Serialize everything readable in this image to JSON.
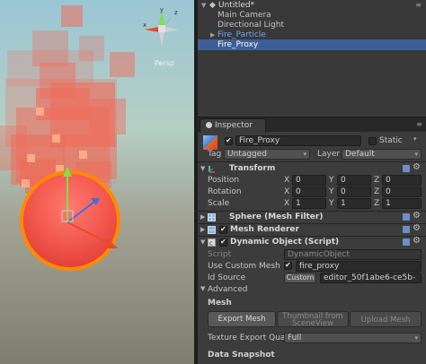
{
  "scene": {
    "view_label": "Persp",
    "gizmo_axes": [
      "y",
      "x",
      "z"
    ]
  },
  "hierarchy": {
    "scene_title": "Untitled*",
    "items": [
      {
        "label": "Main Camera"
      },
      {
        "label": "Directional Light"
      },
      {
        "label": "Fire_Particle"
      },
      {
        "label": "Fire_Proxy"
      }
    ],
    "selected": "Fire_Proxy"
  },
  "inspector": {
    "tab_label": "Inspector",
    "object": {
      "name": "Fire_Proxy",
      "active": true,
      "static_label": "Static",
      "tag_label": "Tag",
      "tag_value": "Untagged",
      "layer_label": "Layer",
      "layer_value": "Default"
    },
    "transform": {
      "title": "Transform",
      "rows": [
        {
          "label": "Position",
          "x": "0",
          "y": "0",
          "z": "0"
        },
        {
          "label": "Rotation",
          "x": "0",
          "y": "0",
          "z": "0"
        },
        {
          "label": "Scale",
          "x": "1",
          "y": "1",
          "z": "1"
        }
      ],
      "axis_x": "X",
      "axis_y": "Y",
      "axis_z": "Z"
    },
    "mesh_filter": {
      "title": "Sphere (Mesh Filter)"
    },
    "mesh_renderer": {
      "title": "Mesh Renderer",
      "enabled": true
    },
    "dynamic_object": {
      "title": "Dynamic Object (Script)",
      "enabled": true,
      "script_label": "Script",
      "script_value": "DynamicObject",
      "use_custom_mesh_label": "Use Custom Mesh",
      "use_custom_mesh_value": "fire_proxy",
      "id_source_label": "Id Source",
      "id_source_mode": "Custom",
      "id_source_value": "editor_50f1abe6-ce5b-",
      "advanced_label": "Advanced",
      "mesh_section": "Mesh",
      "export_mesh": "Export Mesh",
      "thumbnail_line1": "Thumbnail from",
      "thumbnail_line2": "SceneView",
      "upload_mesh": "Upload Mesh",
      "texture_export_label": "Texture Export Quali",
      "texture_export_value": "Full",
      "data_snapshot_section": "Data Snapshot"
    }
  },
  "colors": {
    "selection": "#3e5f96",
    "sphere": "#f45a50",
    "sphere_outline": "#ff8a00",
    "particle": "#f06b5a"
  }
}
